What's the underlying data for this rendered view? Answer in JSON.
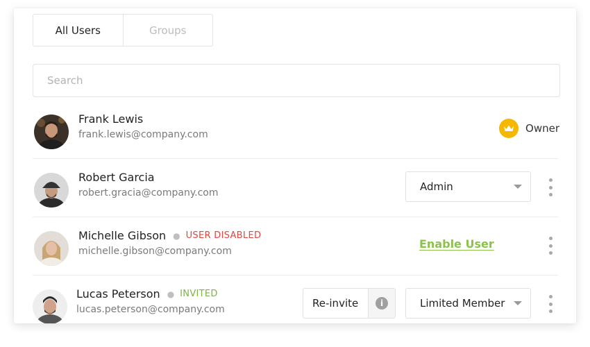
{
  "tabs": [
    {
      "label": "All Users",
      "active": true
    },
    {
      "label": "Groups",
      "active": false
    }
  ],
  "search": {
    "placeholder": "Search",
    "value": ""
  },
  "users": [
    {
      "name": "Frank Lewis",
      "email": "frank.lewis@company.com",
      "role": "Owner",
      "role_icon": "crown-icon"
    },
    {
      "name": "Robert Garcia",
      "email": "robert.gracia@company.com",
      "role": "Admin"
    },
    {
      "name": "Michelle Gibson",
      "email": "michelle.gibson@company.com",
      "status": "USER DISABLED",
      "action": "Enable User"
    },
    {
      "name": "Lucas Peterson",
      "email": "lucas.peterson@company.com",
      "status": "INVITED",
      "action": "Re-invite",
      "info_icon": "i",
      "role": "Limited Member"
    }
  ],
  "colors": {
    "owner_badge": "#f5b700",
    "disabled": "#e0463f",
    "invited": "#7cb342",
    "enable_link": "#8bc34a"
  }
}
